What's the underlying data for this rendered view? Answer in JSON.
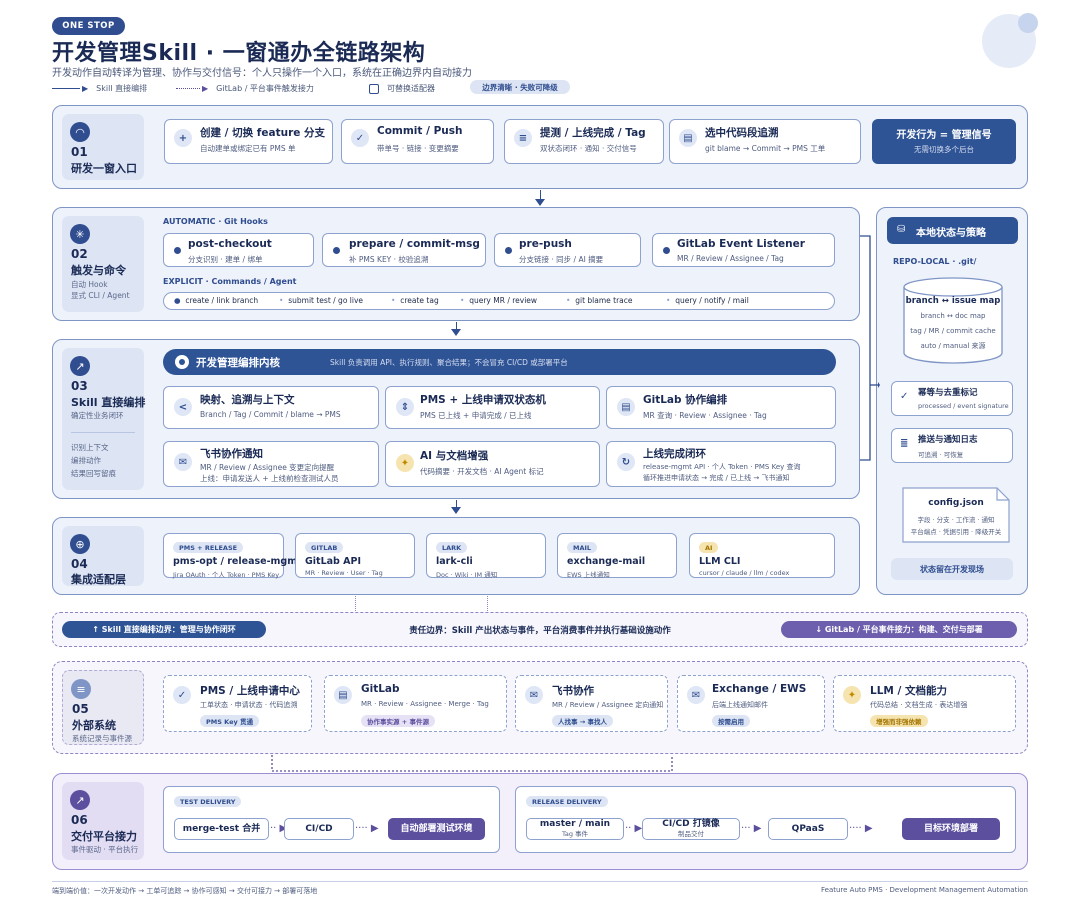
{
  "header": {
    "badge": "ONE STOP",
    "title": "开发管理Skill · 一窗通办全链路架构",
    "subtitle": "开发动作自动转译为管理、协作与交付信号：个人只操作一个入口，系统在正确边界内自动接力",
    "legend_solid": "Skill 直接编排",
    "legend_dotted": "GitLab / 平台事件触发接力",
    "legend_checkbox": "可替换适配器",
    "legend_pill": "边界清晰 · 失败可降级"
  },
  "s01": {
    "num": "01",
    "name": "研发一窗入口",
    "cards": [
      {
        "title": "创建 / 切换 feature 分支",
        "sub": "自动建单或绑定已有 PMS 单",
        "icon": "+"
      },
      {
        "title": "Commit / Push",
        "sub": "带单号 · 链接 · 变更摘要",
        "icon": "✓"
      },
      {
        "title": "提测 / 上线完成 / Tag",
        "sub": "双状态闭环 · 通知 · 交付信号",
        "icon": "≡"
      },
      {
        "title": "选中代码段追溯",
        "sub": "git blame → Commit → PMS 工单",
        "icon": "▤"
      }
    ],
    "highlight_title": "开发行为 = 管理信号",
    "highlight_sub": "无需切换多个后台"
  },
  "s02": {
    "num": "02",
    "name": "触发与命令",
    "desc1": "自动 Hook",
    "desc2": "显式 CLI / Agent",
    "auto_label": "AUTOMATIC · Git Hooks",
    "hooks": [
      {
        "title": "post-checkout",
        "sub": "分支识别 · 建单 / 绑单"
      },
      {
        "title": "prepare / commit-msg",
        "sub": "补 PMS KEY · 校验追溯"
      },
      {
        "title": "pre-push",
        "sub": "分支链接 · 同步 / AI 摘要"
      },
      {
        "title": "GitLab Event Listener",
        "sub": "MR / Review / Assignee / Tag"
      }
    ],
    "explicit_label": "EXPLICIT · Commands / Agent",
    "commands": [
      "create / link branch",
      "submit test / go live",
      "create tag",
      "query MR / review",
      "git blame trace",
      "query / notify / mail"
    ]
  },
  "s03": {
    "num": "03",
    "name": "Skill 直接编排",
    "desc": "确定性业务闭环",
    "list": [
      "识别上下文",
      "编排动作",
      "结果回写留痕"
    ],
    "banner_title": "开发管理编排内核",
    "banner_sub": "Skill 负责调用 API、执行规则、聚合结果；不会冒充 CI/CD 或部署平台",
    "cards": [
      {
        "title": "映射、追溯与上下文",
        "sub": "Branch / Tag / Commit / blame → PMS",
        "sub2": "",
        "icon": "<"
      },
      {
        "title": "PMS + 上线申请双状态机",
        "sub": "PMS 已上线 + 申请完成 / 已上线",
        "sub2": "",
        "icon": "⇕"
      },
      {
        "title": "GitLab 协作编排",
        "sub": "MR 查询 · Review · Assignee · Tag",
        "sub2": "",
        "icon": "▤"
      },
      {
        "title": "飞书协作通知",
        "sub": "MR / Review / Assignee 变更定向提醒",
        "sub2": "上线：申请发送人 + 上线前检查测试人员",
        "icon": "✉"
      },
      {
        "title": "AI 与文档增强",
        "sub": "代码摘要 · 开发文档 · AI Agent 标记",
        "sub2": "",
        "icon": "✦"
      },
      {
        "title": "上线完成闭环",
        "sub": "release-mgmt API · 个人 Token · PMS Key 查询",
        "sub2": "循环推进申请状态 → 完成 / 已上线 → 飞书通知",
        "icon": "↻"
      }
    ]
  },
  "s04": {
    "num": "04",
    "name": "集成适配层",
    "cards": [
      {
        "tag": "PMS + RELEASE",
        "title": "pms-opt / release-mgmt",
        "sub": "Jira OAuth · 个人 Token · PMS Key"
      },
      {
        "tag": "GITLAB",
        "title": "GitLab API",
        "sub": "MR · Review · User · Tag"
      },
      {
        "tag": "LARK",
        "title": "lark-cli",
        "sub": "Doc · Wiki · IM 通知"
      },
      {
        "tag": "MAIL",
        "title": "exchange-mail",
        "sub": "EWS 上线通知"
      },
      {
        "tag": "AI",
        "title": "LLM CLI",
        "sub": "cursor / claude / llm / codex"
      }
    ]
  },
  "side": {
    "title": "本地状态与策略",
    "repo_label": "REPO-LOCAL · .git/",
    "db_title": "branch ↔ issue map",
    "db_lines": [
      "branch ↔ doc map",
      "tag / MR / commit cache",
      "auto / manual 来源"
    ],
    "idem_title": "幂等与去重标记",
    "idem_sub": "processed / event signature",
    "log_title": "推送与通知日志",
    "log_sub": "可追溯 · 可恢复",
    "config_title": "config.json",
    "config_lines": [
      "字段 · 分支 · 工作流 · 通知",
      "平台端点 · 凭据引用 · 降级开关"
    ],
    "footer_pill": "状态留在开发现场"
  },
  "boundary": {
    "left": "↑ Skill 直接编排边界：管理与协作闭环",
    "center": "责任边界：Skill 产出状态与事件，平台消费事件并执行基础设施动作",
    "right": "↓ GitLab / 平台事件接力：构建、交付与部署"
  },
  "s05": {
    "num": "05",
    "name": "外部系统",
    "desc": "系统记录与事件源",
    "cards": [
      {
        "title": "PMS / 上线申请中心",
        "sub": "工单状态 · 申请状态 · 代码追溯",
        "tag": "PMS Key 贯通",
        "icon": "✓"
      },
      {
        "title": "GitLab",
        "sub": "MR · Review · Assignee · Merge · Tag",
        "tag": "协作事实源 + 事件源",
        "icon": "▤"
      },
      {
        "title": "飞书协作",
        "sub": "MR / Review / Assignee 定向通知",
        "tag": "人找事 → 事找人",
        "icon": "✉"
      },
      {
        "title": "Exchange / EWS",
        "sub": "后端上线通知邮件",
        "tag": "按需启用",
        "icon": "✉"
      },
      {
        "title": "LLM / 文档能力",
        "sub": "代码总结 · 文档生成 · 表达增强",
        "tag": "增强而非强依赖",
        "icon": "✦"
      }
    ]
  },
  "s06": {
    "num": "06",
    "name": "交付平台接力",
    "desc": "事件驱动 · 平台执行",
    "test_label": "TEST DELIVERY",
    "test_flow": [
      "merge-test 合并",
      "CI/CD",
      "自动部署测试环境"
    ],
    "release_label": "RELEASE DELIVERY",
    "release_flow": [
      {
        "title": "master / main",
        "sub": "Tag 事件"
      },
      {
        "title": "CI/CD 打镜像",
        "sub": "制品交付"
      },
      {
        "title": "QPaaS",
        "sub": ""
      },
      {
        "title": "目标环境部署",
        "sub": ""
      }
    ]
  },
  "footer": {
    "left": "端到端价值：一次开发动作 → 工单可追踪 → 协作可感知 → 交付可接力 → 部署可落地",
    "right": "Feature Auto PMS · Development Management Automation"
  },
  "colors": {
    "primary": "#2f4d8f",
    "purple": "#5b4f9e",
    "bg_section": "#eef2fa"
  }
}
